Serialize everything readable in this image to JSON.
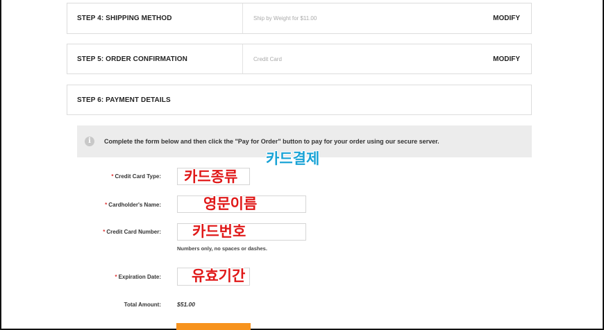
{
  "steps": {
    "step4": {
      "title": "STEP 4: SHIPPING METHOD",
      "detail": "Ship by Weight for $11.00",
      "modify": "MODIFY"
    },
    "step5": {
      "title": "STEP 5: ORDER CONFIRMATION",
      "detail": "Credit Card",
      "modify": "MODIFY"
    },
    "step6": {
      "title": "STEP 6: PAYMENT DETAILS"
    }
  },
  "notice": {
    "icon": "info-icon",
    "text": "Complete the form below and then click the \"Pay for Order\" button to pay for your order using our secure server."
  },
  "form": {
    "required_mark": "*",
    "card_type_label": "Credit Card Type:",
    "cardholder_label": "Cardholder's Name:",
    "card_number_label": "Credit Card Number:",
    "card_number_hint": "Numbers only, no spaces or dashes.",
    "expiration_label": "Expiration Date:",
    "total_label": "Total Amount:",
    "total_value": "$51.00"
  },
  "annotations": {
    "card_payment": "카드결제",
    "card_type": "카드종류",
    "english_name": "영문이름",
    "card_number": "카드번호",
    "expiry": "유효기간"
  },
  "colors": {
    "accent_button": "#f7931e",
    "required": "#dd3333",
    "annotation_red": "#e01818",
    "annotation_cyan": "#1aa3d6"
  }
}
